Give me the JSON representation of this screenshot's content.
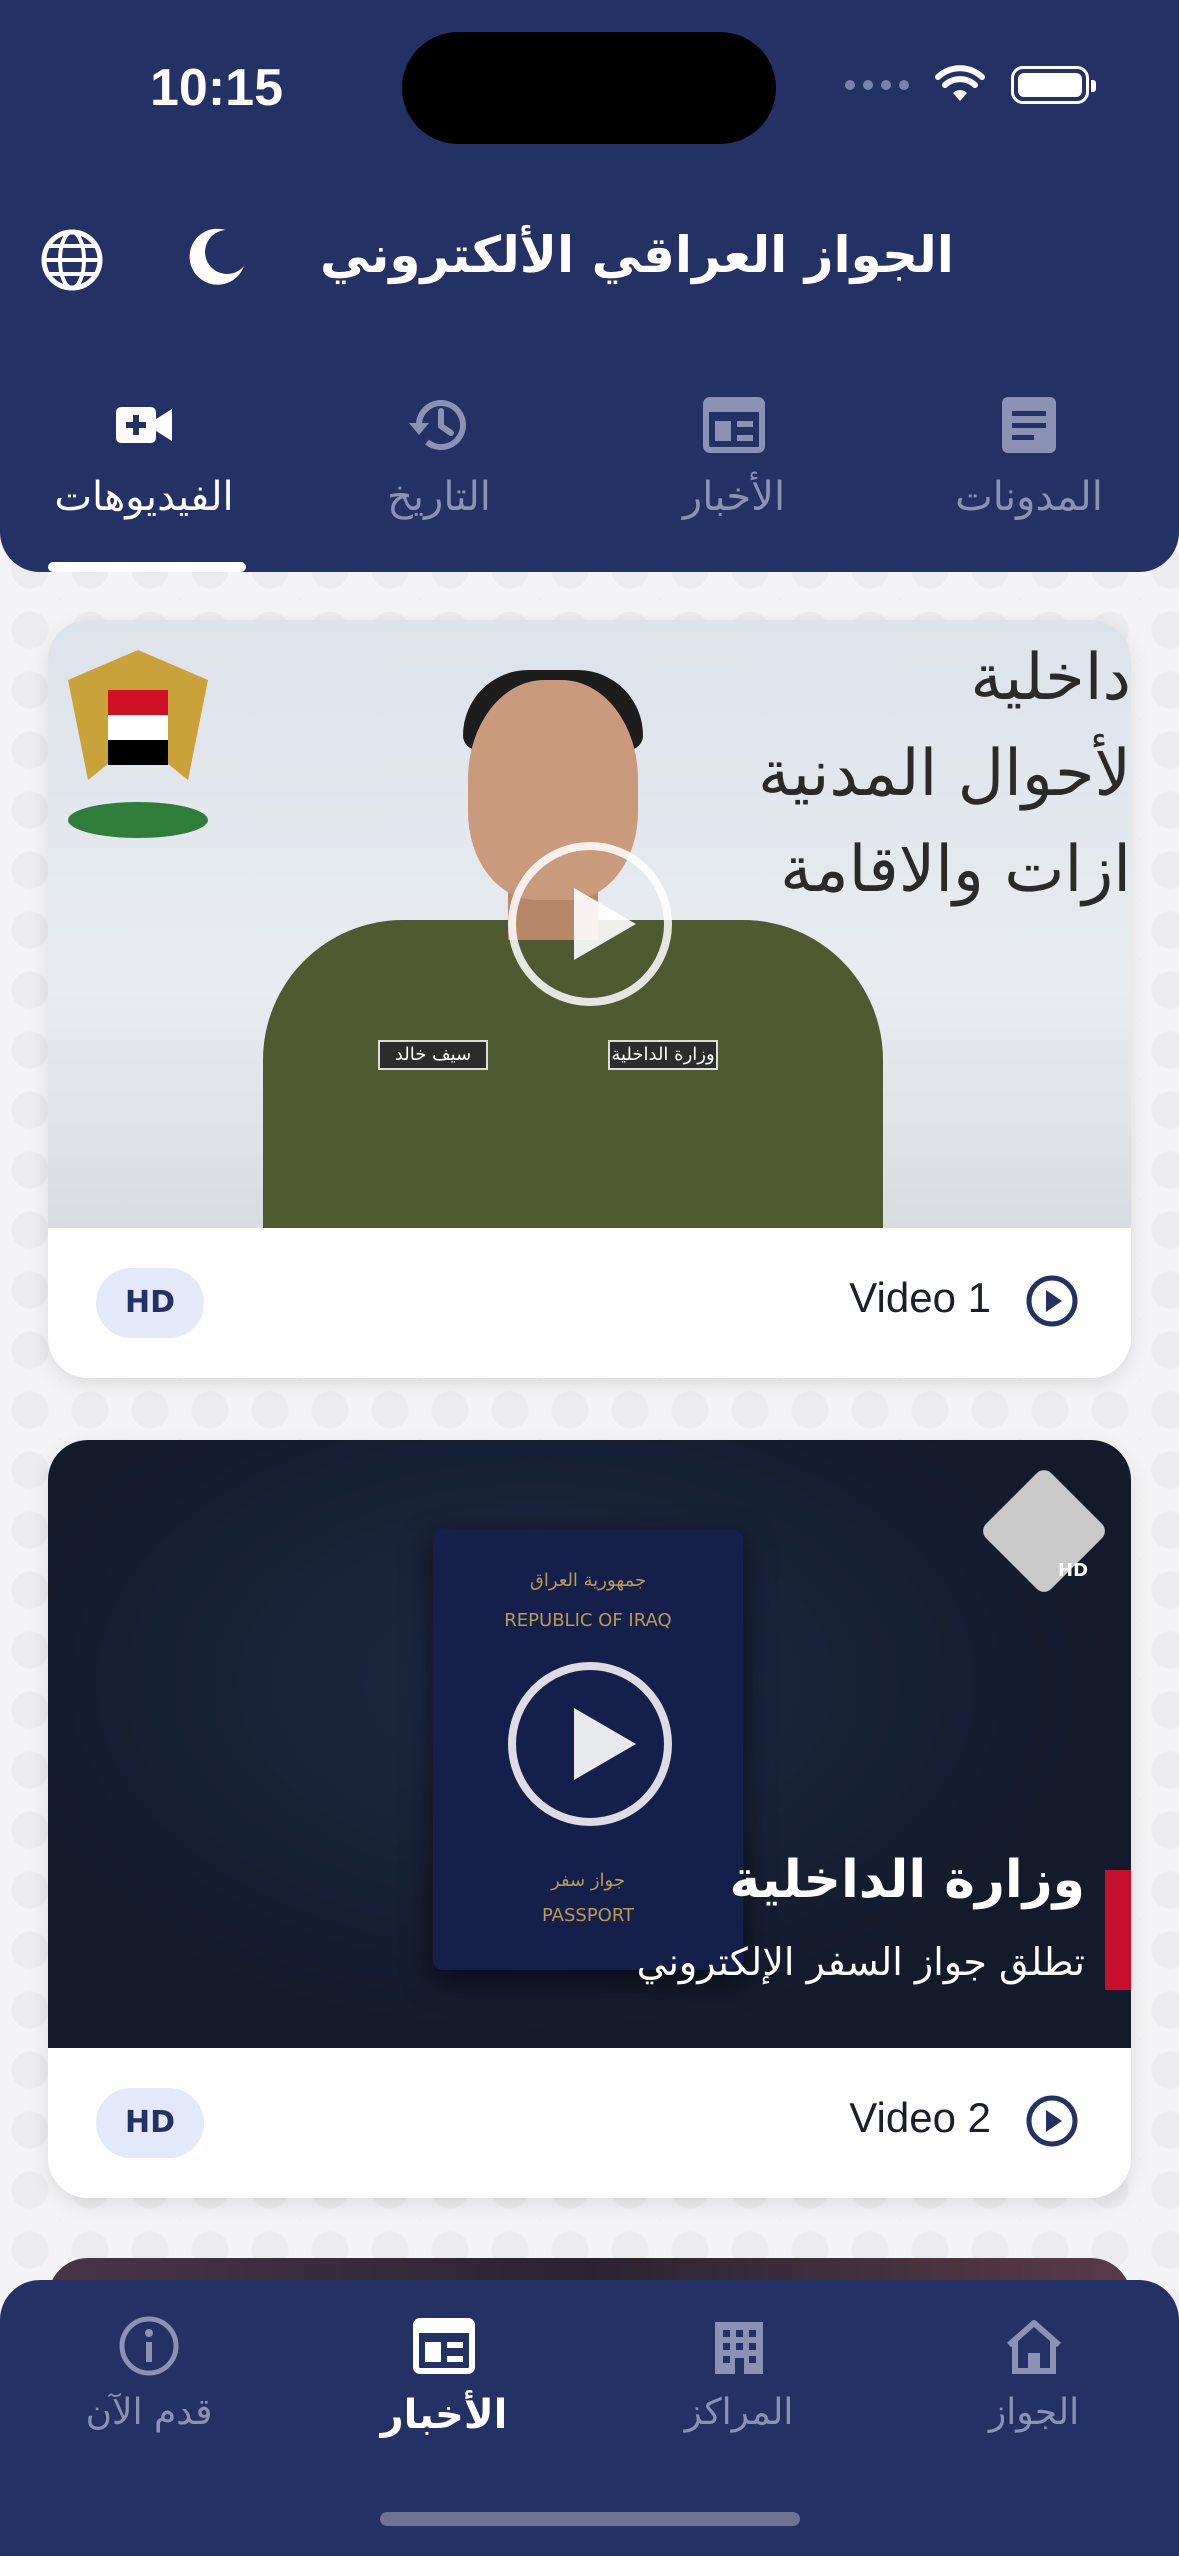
{
  "status_bar": {
    "time": "10:15"
  },
  "header": {
    "title": "الجواز العراقي الألكتروني",
    "tabs": [
      {
        "label": "المدونات",
        "icon": "document-icon"
      },
      {
        "label": "الأخبار",
        "icon": "newspaper-icon"
      },
      {
        "label": "التاريخ",
        "icon": "history-icon"
      },
      {
        "label": "الفيديوهات",
        "icon": "video-add-icon",
        "active": true
      }
    ]
  },
  "videos": [
    {
      "title": "Video 1",
      "badge": "HD",
      "thumbnail_text": [
        "داخلية",
        "لأحوال المدنية",
        "ازات والاقامة"
      ],
      "tags": [
        "سيف خالد",
        "وزارة الداخلية"
      ]
    },
    {
      "title": "Video 2",
      "badge": "HD",
      "thumbnail_headline": "وزارة الداخلية",
      "thumbnail_subline": "تطلق جواز السفر الإلكتروني",
      "passport_text": [
        "جمهورية العراق",
        "REPUBLIC OF IRAQ",
        "جواز سفر",
        "PASSPORT"
      ],
      "channel_badge": "HD"
    }
  ],
  "bottom_nav": [
    {
      "label": "الجواز",
      "icon": "home-icon"
    },
    {
      "label": "المراكز",
      "icon": "building-icon"
    },
    {
      "label": "الأخبار",
      "icon": "newspaper-icon",
      "active": true
    },
    {
      "label": "قدم الآن",
      "icon": "info-icon"
    }
  ],
  "colors": {
    "primary": "#233164",
    "inactive": "#8a93b4",
    "badge_bg": "#e4e8fb",
    "accent_red": "#c8102e"
  }
}
